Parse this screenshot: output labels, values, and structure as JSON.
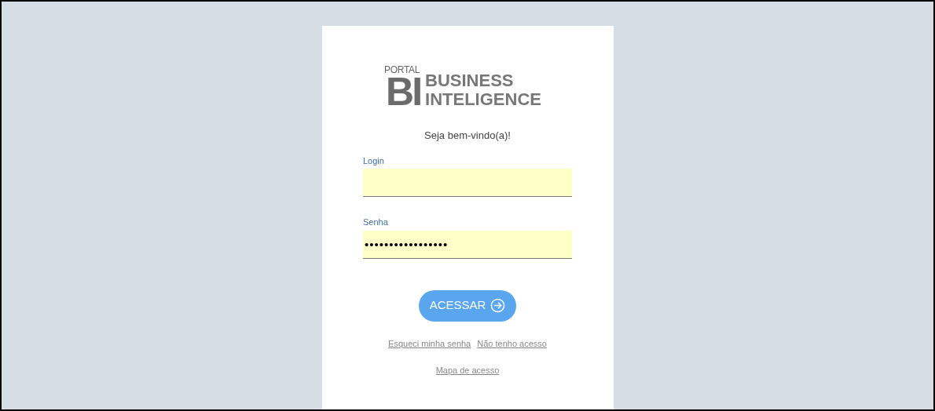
{
  "logo": {
    "portal": "PORTAL",
    "mark": "BI",
    "line_1": "BUSINESS",
    "line_2": "INTELIGENCE"
  },
  "welcome": "Seja bem-vindo(a)!",
  "fields": [
    {
      "label": "Login"
    },
    {
      "label": "Senha",
      "value": "•••••••••••••••••"
    }
  ],
  "submit": {
    "label": "ACESSAR"
  },
  "links": [
    "Esqueci minha senha",
    "Não tenho acesso"
  ],
  "bottom_link": "Mapa de acesso"
}
